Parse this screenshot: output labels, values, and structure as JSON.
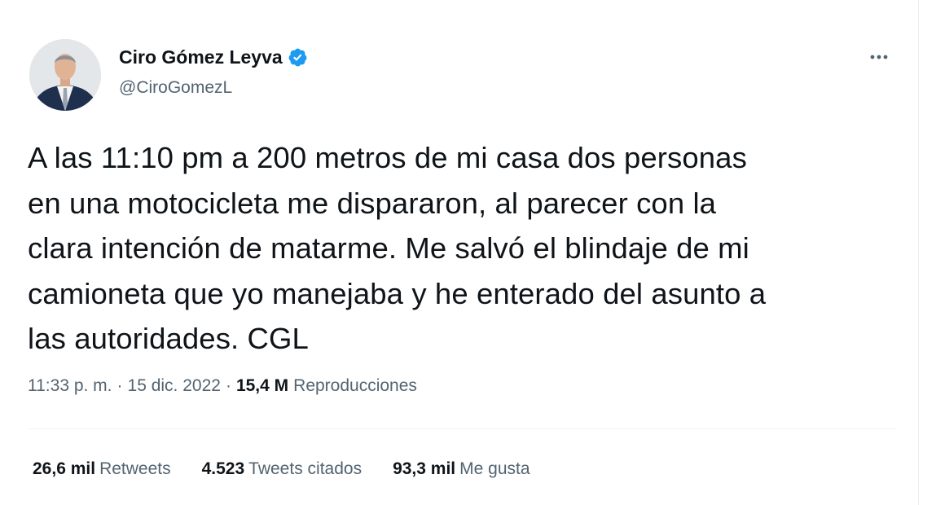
{
  "author": {
    "display_name": "Ciro Gómez Leyva",
    "handle": "@CiroGomezL",
    "verified_icon": "verified-badge-icon",
    "verified_color": "#1d9bf0"
  },
  "tweet": {
    "text": "A las 11:10 pm a 200 metros de mi casa dos personas\nen una motocicleta me dispararon, al parecer con la\nclara intención de matarme. Me salvó el blindaje de mi\ncamioneta que yo manejaba y he enterado del asunto a\nlas autoridades. CGL",
    "time": "11:33 p. m.",
    "separator": "·",
    "date": "15 dic. 2022",
    "views_count": "15,4 M",
    "views_label": "Reproducciones"
  },
  "stats": {
    "retweets_count": "26,6 mil",
    "retweets_label": "Retweets",
    "quotes_count": "4.523",
    "quotes_label": "Tweets citados",
    "likes_count": "93,3 mil",
    "likes_label": "Me gusta"
  },
  "icons": {
    "more": "more-options-icon"
  }
}
